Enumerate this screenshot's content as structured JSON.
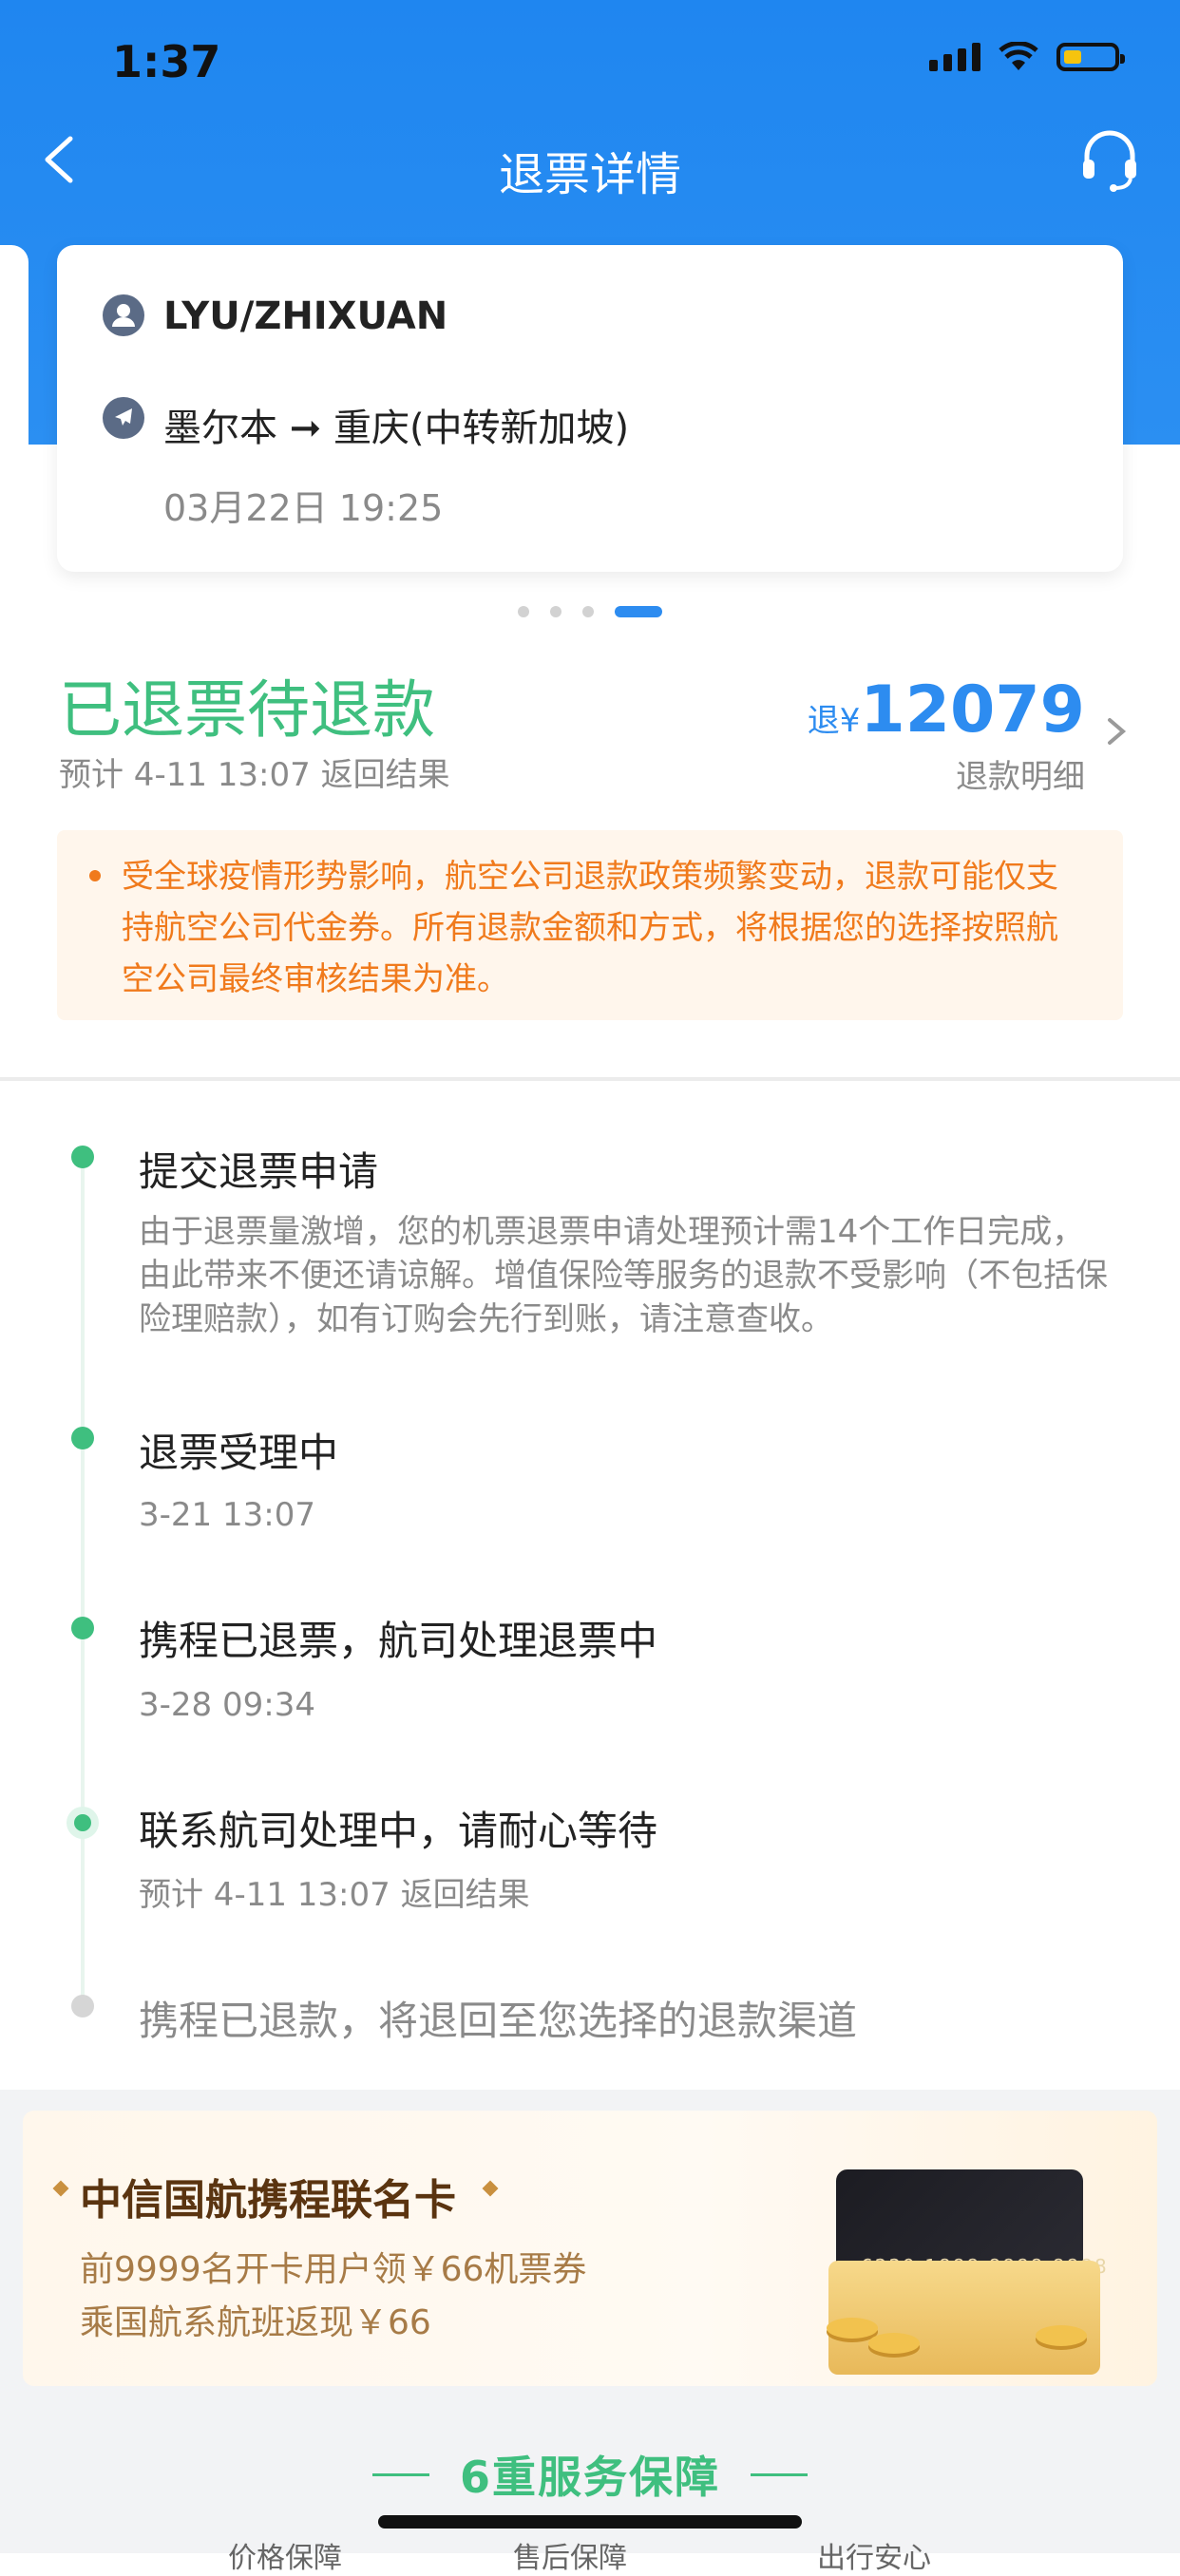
{
  "status_bar": {
    "time": "1:37"
  },
  "nav": {
    "title": "退票详情"
  },
  "ticket": {
    "passenger": "LYU/ZHIXUAN",
    "route": "墨尔本 ➞ 重庆(中转新加坡)",
    "datetime": "03月22日 19:25"
  },
  "refund": {
    "status": "已退票待退款",
    "estimate": "预计 4-11 13:07 返回结果",
    "amount_prefix": "退¥",
    "amount": "12079",
    "detail_link": "退款明细"
  },
  "notice": "受全球疫情形势影响，航空公司退款政策频繁变动，退款可能仅支持航空公司代金券。所有退款金额和方式，将根据您的选择按照航空公司最终审核结果为准。",
  "timeline": [
    {
      "title": "提交退票申请",
      "sub": "由于退票量激增，您的机票退票申请处理预计需14个工作日完成，由此带来不便还请谅解。增值保险等服务的退款不受影响（不包括保险理赔款），如有订购会先行到账，请注意查收。"
    },
    {
      "title": "退票受理中",
      "sub": "3-21 13:07"
    },
    {
      "title": "携程已退票，航司处理退票中",
      "sub": "3-28 09:34"
    },
    {
      "title": "联系航司处理中，请耐心等待",
      "sub": "预计 4-11 13:07 返回结果"
    },
    {
      "title": "携程已退款，将退回至您选择的退款渠道",
      "sub": ""
    }
  ],
  "promo": {
    "title": "中信国航携程联名卡",
    "line1": "前9999名开卡用户领￥66机票券",
    "line2": "乘国航系航班返现￥66",
    "card_number": "6229 1888 8888 8888"
  },
  "services": {
    "title": "6重服务保障",
    "peek": [
      "价格保障",
      "售后保障",
      "出行安心"
    ]
  },
  "colors": {
    "header": "#2b8ff2",
    "accent_green": "#3fbf7f",
    "accent_blue": "#2d8cf0",
    "notice_orange": "#f07a1c"
  }
}
